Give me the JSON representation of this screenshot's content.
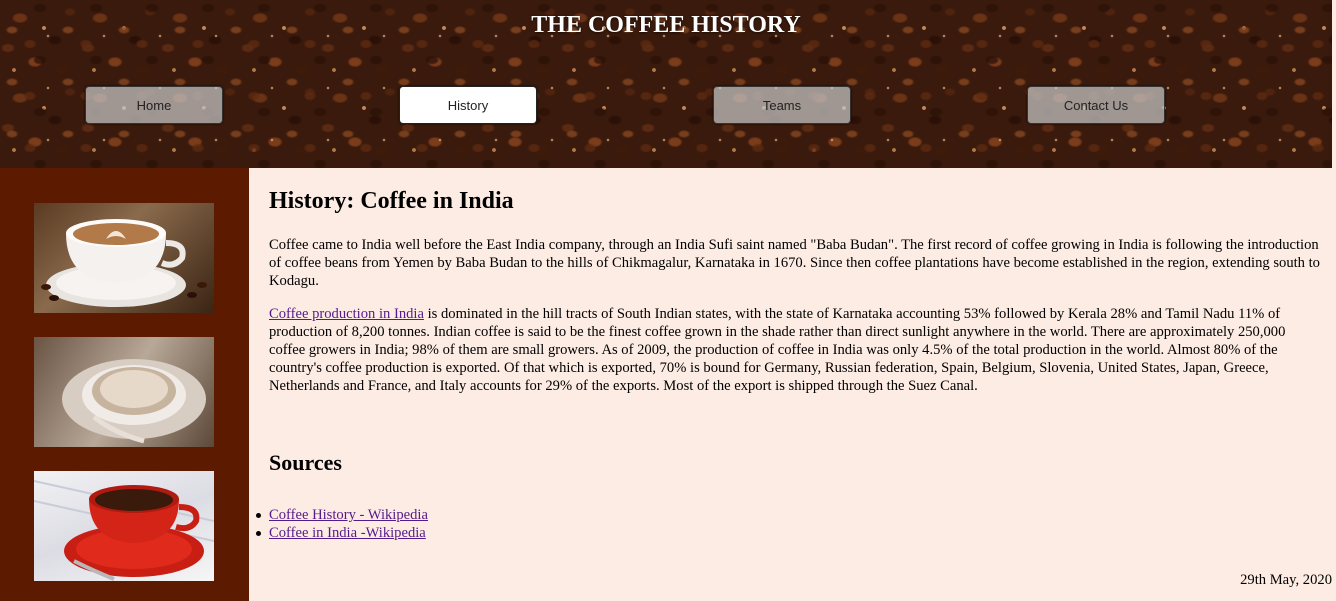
{
  "header": {
    "title": "THE COFFEE HISTORY",
    "nav": [
      {
        "label": "Home",
        "active": false
      },
      {
        "label": "History",
        "active": true
      },
      {
        "label": "Teams",
        "active": false
      },
      {
        "label": "Contact Us",
        "active": false
      }
    ]
  },
  "sidebar": {
    "images": [
      "latte-art-cup-image",
      "cappuccino-cup-image",
      "red-coffee-cup-image"
    ]
  },
  "main": {
    "title": "History: Coffee in India",
    "para1": "Coffee came to India well before the East India company, through an India Sufi saint named \"Baba Budan\". The first record of coffee growing in India is following the introduction of coffee beans from Yemen by Baba Budan to the hills of Chikmagalur, Karnataka in 1670. Since then coffee plantations have become established in the region, extending south to Kodagu.",
    "para2_link": "Coffee production in India",
    "para2_rest": " is dominated in the hill tracts of South Indian states, with the state of Karnataka accounting 53% followed by Kerala 28% and Tamil Nadu 11% of production of 8,200 tonnes. Indian coffee is said to be the finest coffee grown in the shade rather than direct sunlight anywhere in the world. There are approximately 250,000 coffee growers in India; 98% of them are small growers. As of 2009, the production of coffee in India was only 4.5% of the total production in the world. Almost 80% of the country's coffee production is exported. Of that which is exported, 70% is bound for Germany, Russian federation, Spain, Belgium, Slovenia, United States, Japan, Greece, Netherlands and France, and Italy accounts for 29% of the exports. Most of the export is shipped through the Suez Canal.",
    "sources_title": "Sources",
    "sources": [
      "Coffee History - Wikipedia",
      "Coffee in India -Wikipedia"
    ]
  },
  "footer": {
    "date": "29th May, 2020"
  },
  "colors": {
    "sidebar": "#5c1a00",
    "content_bg": "#fdece4",
    "link": "#551a8b"
  }
}
